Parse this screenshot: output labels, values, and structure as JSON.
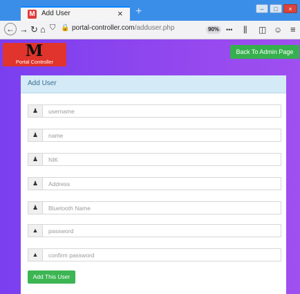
{
  "browser": {
    "tab_title": "Add User",
    "tab_close": "×",
    "new_tab": "+",
    "url_host": "portal-controller.com",
    "url_path": "/adduser.php",
    "zoom": "90%",
    "more": "•••",
    "icons": [
      "back-icon",
      "forward-icon",
      "reload-icon",
      "home-icon",
      "shield-icon",
      "lock-icon",
      "library-icon",
      "sidebar-icon",
      "account-icon",
      "menu-icon"
    ]
  },
  "header": {
    "logo_letter": "M",
    "logo_text": "Portal Controller",
    "admin_button": "Back To Admin Page"
  },
  "panel": {
    "title": "Add User",
    "fields": [
      {
        "placeholder": "username",
        "icon": "user-icon"
      },
      {
        "placeholder": "name",
        "icon": "user-icon"
      },
      {
        "placeholder": "NIK",
        "icon": "user-icon"
      },
      {
        "placeholder": "Address",
        "icon": "user-icon"
      },
      {
        "placeholder": "Bluetooth Name",
        "icon": "user-icon"
      },
      {
        "placeholder": "password",
        "icon": "lock-icon"
      },
      {
        "placeholder": "confirm password",
        "icon": "lock-icon"
      }
    ],
    "submit": "Add This User"
  },
  "colors": {
    "accent": "#8d46ef",
    "button_green": "#36b04e",
    "panel_head": "#d4eaf7"
  }
}
